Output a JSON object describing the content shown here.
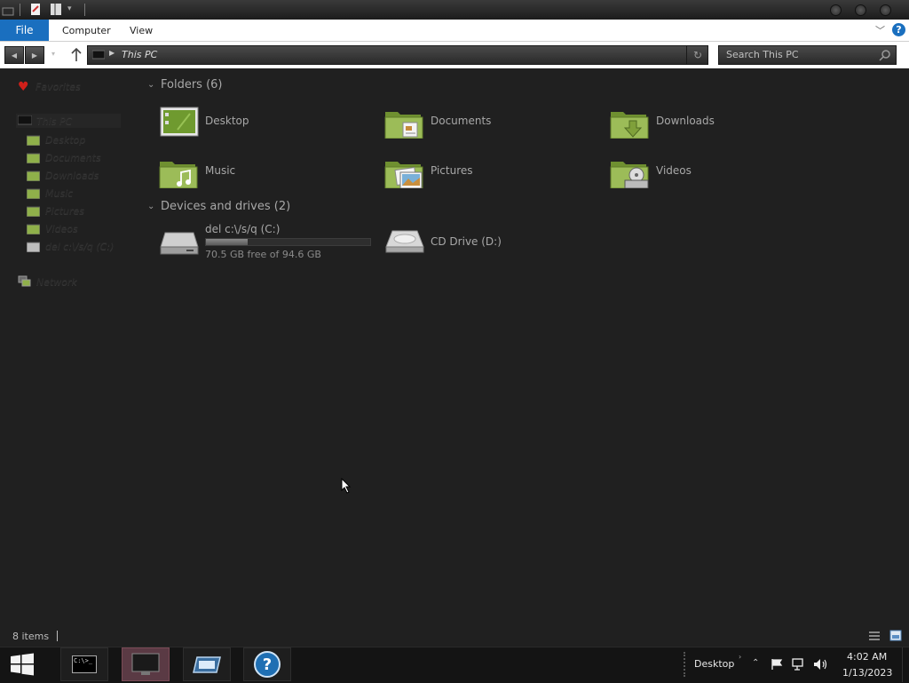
{
  "window": {
    "ribbon_tabs": {
      "file": "File",
      "computer": "Computer",
      "view": "View"
    },
    "help_icon_text": "?"
  },
  "address": {
    "location": "This PC"
  },
  "search": {
    "placeholder": "Search This PC"
  },
  "sidebar": {
    "favorites": "Favorites",
    "this_pc": "This PC",
    "children": [
      "Desktop",
      "Documents",
      "Downloads",
      "Music",
      "Pictures",
      "Videos",
      "del c:\\/s/q (C:)"
    ],
    "network": "Network"
  },
  "content": {
    "folders_header": "Folders (6)",
    "folders": [
      "Desktop",
      "Documents",
      "Downloads",
      "Music",
      "Pictures",
      "Videos"
    ],
    "devices_header": "Devices and drives (2)",
    "drives": [
      {
        "name": "del c:\\/s/q (C:)",
        "free": "70.5 GB free of 94.6 GB",
        "used_fraction": 0.255
      },
      {
        "name": "CD Drive (D:)"
      }
    ]
  },
  "status": {
    "items": "8 items"
  },
  "taskbar": {
    "cmd_text": "C:\\>_",
    "help_text": "?",
    "desktop_label": "Desktop",
    "time": "4:02 AM",
    "date": "1/13/2023"
  },
  "colors": {
    "accent": "#1a6fbf",
    "folder_green": "#8fb04a",
    "background": "#202020"
  }
}
